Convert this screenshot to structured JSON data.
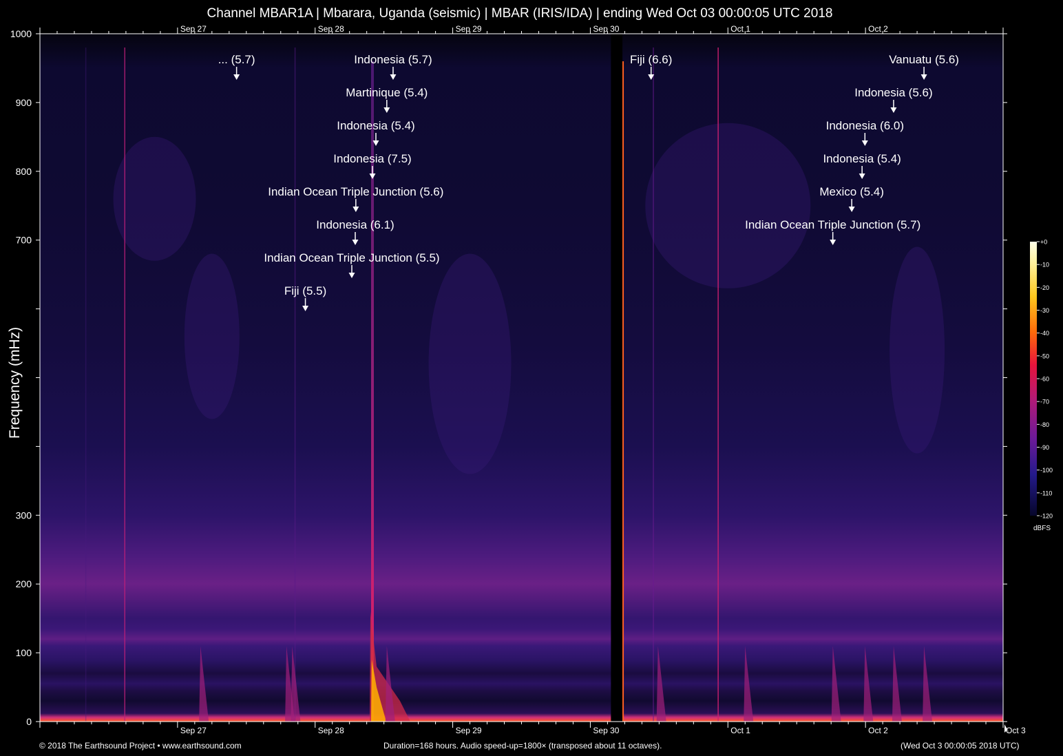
{
  "header": {
    "title": "Channel MBAR1A | Mbarara, Uganda (seismic) | MBAR (IRIS/IDA) | ending Wed Oct 03 00:00:05 UTC 2018"
  },
  "footer": {
    "credit": "© 2018 The Earthsound Project • www.earthsound.com",
    "duration": "Duration=168 hours. Audio speed-up=1800× (transposed about 11 octaves).",
    "end_time": "(Wed Oct  3 00:00:05 2018 UTC)"
  },
  "colors": {
    "background": "#000000",
    "spectrogram_floor": "#0c0826",
    "band_magenta": "#8a1f86",
    "quake_trace": "#ff3a3a",
    "annotation": "#ffffff"
  },
  "chart_data": {
    "type": "heatmap",
    "title": "Channel MBAR1A | Mbarara, Uganda (seismic) | MBAR (IRIS/IDA) | ending Wed Oct 03 00:00:05 UTC 2018",
    "ylabel": "Frequency (mHz)",
    "xlabel": "",
    "ylim": [
      0,
      1000
    ],
    "xlim_hours": [
      0,
      168
    ],
    "y_ticks": [
      {
        "value": 0,
        "label": "0"
      },
      {
        "value": 100,
        "label": "100"
      },
      {
        "value": 200,
        "label": "200"
      },
      {
        "value": 300,
        "label": "300"
      },
      {
        "value": 400,
        "label": ""
      },
      {
        "value": 500,
        "label": ""
      },
      {
        "value": 600,
        "label": ""
      },
      {
        "value": 700,
        "label": "700"
      },
      {
        "value": 800,
        "label": "800"
      },
      {
        "value": 900,
        "label": "900"
      },
      {
        "value": 1000,
        "label": "1000"
      }
    ],
    "x_ticks": [
      {
        "hour": 24,
        "label": "Sep 27"
      },
      {
        "hour": 48,
        "label": "Sep 28"
      },
      {
        "hour": 72,
        "label": "Sep 29"
      },
      {
        "hour": 96,
        "label": "Sep 30"
      },
      {
        "hour": 120,
        "label": "Oct  1"
      },
      {
        "hour": 144,
        "label": "Oct  2"
      },
      {
        "hour": 168,
        "label": "Oct  3"
      }
    ],
    "colorbar": {
      "unit": "dBFS",
      "min": -120,
      "max": 0,
      "ticks": [
        "+0",
        "-10",
        "-20",
        "-30",
        "-40",
        "-50",
        "-60",
        "-70",
        "-80",
        "-90",
        "-100",
        "-110",
        "-120"
      ]
    },
    "events": [
      {
        "label": "... (5.7)",
        "hour": 34.3,
        "row": 0
      },
      {
        "label": "Indonesia (5.7)",
        "hour": 61.6,
        "row": 0
      },
      {
        "label": "Martinique (5.4)",
        "hour": 60.5,
        "row": 1
      },
      {
        "label": "Indonesia (5.4)",
        "hour": 58.6,
        "row": 2
      },
      {
        "label": "Indonesia (7.5)",
        "hour": 58.0,
        "row": 3
      },
      {
        "label": "Indian Ocean Triple Junction (5.6)",
        "hour": 55.1,
        "row": 4
      },
      {
        "label": "Indonesia (6.1)",
        "hour": 55.0,
        "row": 5
      },
      {
        "label": "Indian Ocean Triple Junction (5.5)",
        "hour": 54.4,
        "row": 6
      },
      {
        "label": "Fiji (5.5)",
        "hour": 46.3,
        "row": 7
      },
      {
        "label": "Fiji (6.6)",
        "hour": 106.6,
        "row": 0
      },
      {
        "label": "Vanuatu (5.6)",
        "hour": 154.2,
        "row": 0
      },
      {
        "label": "Indonesia (5.6)",
        "hour": 148.9,
        "row": 1
      },
      {
        "label": "Indonesia (6.0)",
        "hour": 143.9,
        "row": 2
      },
      {
        "label": "Indonesia (5.4)",
        "hour": 143.4,
        "row": 3
      },
      {
        "label": "Mexico (5.4)",
        "hour": 141.6,
        "row": 4
      },
      {
        "label": "Indian Ocean Triple Junction (5.7)",
        "hour": 138.3,
        "row": 5
      }
    ],
    "data_gap_hours": [
      99.6,
      101.6
    ],
    "grid": false
  }
}
